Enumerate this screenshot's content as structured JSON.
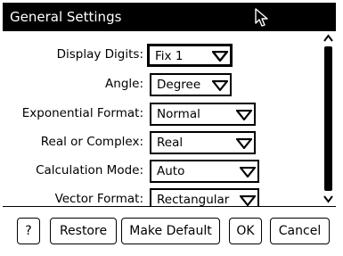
{
  "dialog": {
    "title": "General Settings"
  },
  "settings": [
    {
      "label": "Display Digits:",
      "value": "Fix 1"
    },
    {
      "label": "Angle:",
      "value": "Degree"
    },
    {
      "label": "Exponential Format:",
      "value": "Normal"
    },
    {
      "label": "Real or Complex:",
      "value": "Real"
    },
    {
      "label": "Calculation Mode:",
      "value": "Auto"
    },
    {
      "label": "Vector Format:",
      "value": "Rectangular"
    }
  ],
  "buttons": {
    "help": "?",
    "restore": "Restore",
    "make_default": "Make Default",
    "ok": "OK",
    "cancel": "Cancel"
  },
  "icons": {
    "cursor": "mouse-pointer-icon",
    "dropdown": "triangle-down-icon",
    "scroll_up": "triangle-up-icon",
    "scroll_down": "triangle-down-icon"
  }
}
